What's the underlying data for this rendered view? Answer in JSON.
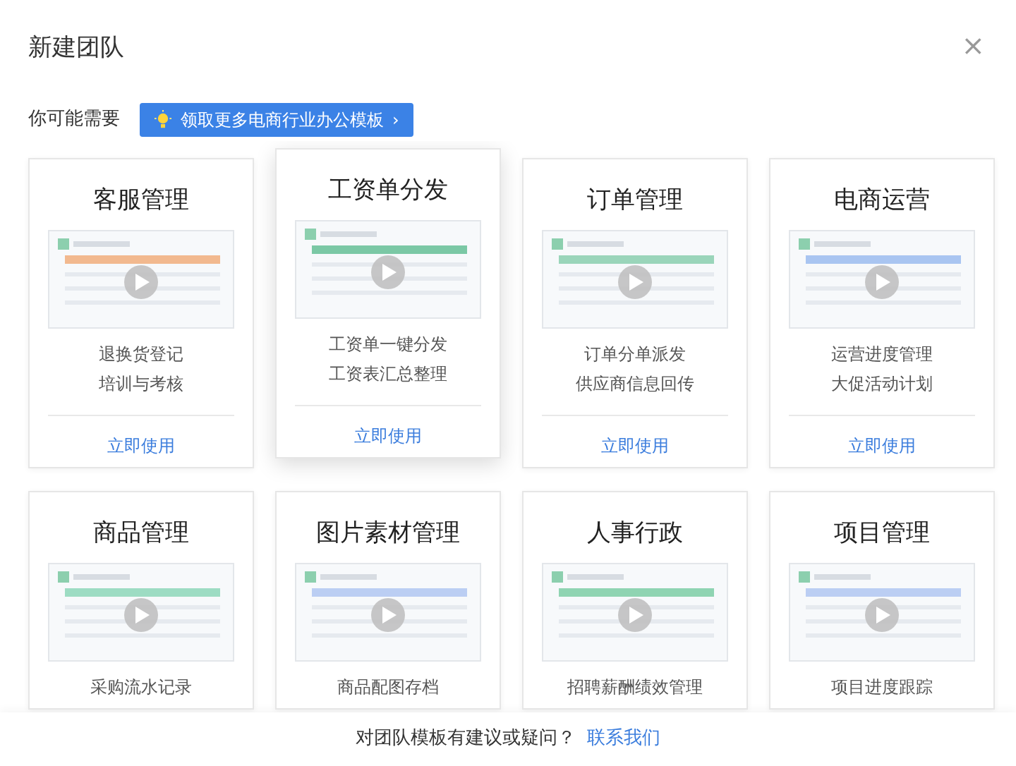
{
  "dialog": {
    "title": "新建团队",
    "close": "×"
  },
  "suggest": {
    "label": "你可能需要",
    "promo": "领取更多电商行业办公模板",
    "promo_arrow": "›"
  },
  "cards": [
    {
      "title": "客服管理",
      "lines": [
        "退换货登记",
        "培训与考核"
      ],
      "action": "立即使用",
      "hovered": false
    },
    {
      "title": "工资单分发",
      "lines": [
        "工资单一键分发",
        "工资表汇总整理"
      ],
      "action": "立即使用",
      "hovered": true
    },
    {
      "title": "订单管理",
      "lines": [
        "订单分单派发",
        "供应商信息回传"
      ],
      "action": "立即使用",
      "hovered": false
    },
    {
      "title": "电商运营",
      "lines": [
        "运营进度管理",
        "大促活动计划"
      ],
      "action": "立即使用",
      "hovered": false
    },
    {
      "title": "商品管理",
      "lines": [
        "采购流水记录"
      ],
      "hovered": false
    },
    {
      "title": "图片素材管理",
      "lines": [
        "商品配图存档"
      ],
      "hovered": false
    },
    {
      "title": "人事行政",
      "lines": [
        "招聘薪酬绩效管理"
      ],
      "hovered": false
    },
    {
      "title": "项目管理",
      "lines": [
        "项目进度跟踪"
      ],
      "hovered": false
    }
  ],
  "footer": {
    "text": "对团队模板有建议或疑问？",
    "link": "联系我们"
  }
}
